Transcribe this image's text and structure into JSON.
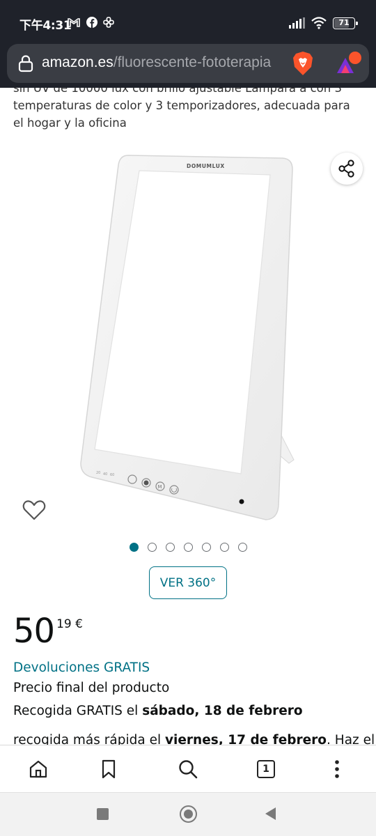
{
  "status_bar": {
    "time": "下午4:31",
    "battery": "71",
    "battery_level": 0.71,
    "icons": [
      "gmail-icon",
      "facebook-icon",
      "pinwheel-icon",
      "signal-icon",
      "wifi-icon",
      "battery-icon"
    ]
  },
  "url_bar": {
    "domain": "amazon.es",
    "path": "/fluorescente-fototerapia",
    "icons": [
      "lock-icon",
      "brave-shield-icon",
      "brave-rewards-icon"
    ]
  },
  "product": {
    "description_partial": "sin UV de 10000 lux con brillo ajustable Lámpara a con 3 temperaturas de color y 3 temporizadores, adecuada para el hogar y la oficina",
    "image_brand": "DOMUMLUX",
    "image_labels": [
      "20",
      "40",
      "60",
      "M"
    ],
    "carousel": {
      "total": 7,
      "active_index": 0
    },
    "view_360_label": "VER 360°",
    "price_whole": "50",
    "price_fraction": "19 €",
    "returns_label": "Devoluciones GRATIS",
    "final_price_label": "Precio final del producto",
    "pickup_prefix": "Recogida GRATIS el ",
    "pickup_date": "sábado, 18 de febrero",
    "fast_pickup_prefix": "recogida más rápida el ",
    "fast_pickup_date": "viernes, 17 de febrero",
    "fast_pickup_suffix": ". Haz el"
  },
  "toolbar": {
    "tab_count": "1",
    "icons": [
      "home-icon",
      "bookmark-icon",
      "search-icon",
      "tabs-icon",
      "more-vertical-icon"
    ]
  },
  "colors": {
    "accent": "#007185",
    "status_bar_bg": "#1f222a",
    "url_pill_bg": "#3a3d44",
    "text": "#0f1111"
  }
}
